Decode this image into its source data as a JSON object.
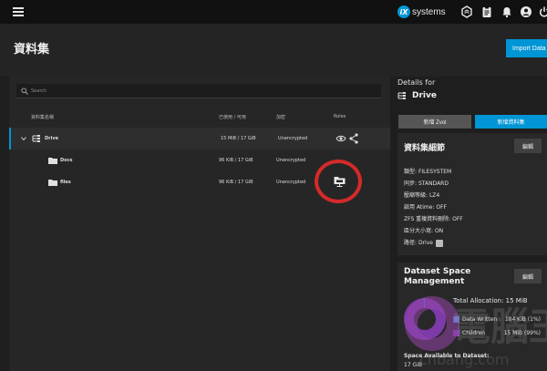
{
  "topbar": {
    "logo_badge": "iX",
    "logo_text": "systems",
    "icons": [
      "menu-icon",
      "truecommand-icon",
      "jobs-icon",
      "notifications-icon",
      "account-icon",
      "power-icon"
    ]
  },
  "header": {
    "title": "資料集",
    "import_label": "Import Data"
  },
  "tree": {
    "search_placeholder": "Search",
    "columns": [
      "資料集名稱",
      "已使用 / 可用",
      "加密",
      "Roles"
    ],
    "rows": [
      {
        "name": "Drive",
        "used": "15 MiB / 17 GiB",
        "encryption": "Unencrypted",
        "roles": [
          "roles-share-icon",
          "roles-share-link-icon"
        ]
      },
      {
        "name": "Docs",
        "used": "96 KiB / 17 GiB",
        "encryption": "Unencrypted",
        "roles": []
      },
      {
        "name": "files",
        "used": "96 KiB / 17 GiB",
        "encryption": "Unencrypted",
        "roles": [
          "smb-share-icon"
        ]
      }
    ]
  },
  "details": {
    "for_label": "Details for",
    "dataset_name": "Drive",
    "add_zvol": "新增 Zvol",
    "add_dataset": "新增資料集",
    "info_title": "資料集細節",
    "edit_label": "編輯",
    "fields": [
      {
        "label": "類型:",
        "value": "FILESYSTEM"
      },
      {
        "label": "同步:",
        "value": "STANDARD"
      },
      {
        "label": "壓縮等級:",
        "value": "LZ4"
      },
      {
        "label": "啟用 Atime:",
        "value": "OFF"
      },
      {
        "label": "ZFS 重複資料刪除:",
        "value": "OFF"
      },
      {
        "label": "區分大小寫:",
        "value": "ON"
      },
      {
        "label": "路徑:",
        "value": "Drive"
      }
    ]
  },
  "space": {
    "title_line1": "Dataset Space",
    "title_line2": "Management",
    "edit_label": "編輯",
    "total_allocation": "Total Allocation:  15 MiB",
    "legend": [
      {
        "label": "Data Written",
        "value": "104 KiB (1%)",
        "color": "#3a8fd0",
        "fraction": 0.01
      },
      {
        "label": "Children",
        "value": "15 MiB (99%)",
        "color": "#7d3aa8",
        "fraction": 0.99
      }
    ],
    "available_label": "Space Available to Dataset:",
    "available_value": "17 GiB"
  },
  "watermark": {
    "text": "電腦王",
    "url": "chbang.com"
  },
  "colors": {
    "accent": "#0095d5",
    "highlight_circle": "#d42a2a"
  }
}
